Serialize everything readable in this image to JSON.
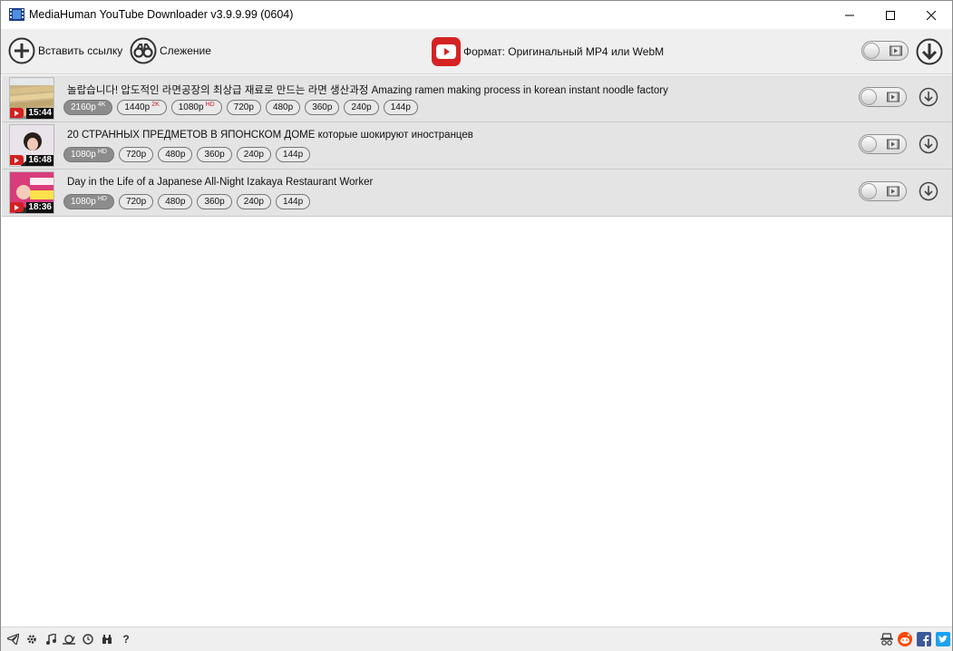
{
  "window": {
    "title": "MediaHuman YouTube Downloader v3.9.9.99 (0604)"
  },
  "toolbar": {
    "paste_label": "Вставить ссылку",
    "tracking_label": "Слежение",
    "format_label": "Формат: Оригинальный MP4 или WebM"
  },
  "items": [
    {
      "title": "놀랍습니다! 압도적인 라면공장의 최상급 재료로 만드는 라면 생산과정 Amazing ramen making process in korean instant noodle factory",
      "duration": "15:44",
      "qualities": [
        {
          "label": "2160p",
          "badge": "4K",
          "selected": true
        },
        {
          "label": "1440p",
          "badge": "2K",
          "selected": false
        },
        {
          "label": "1080p",
          "badge": "HD",
          "selected": false
        },
        {
          "label": "720p",
          "badge": "",
          "selected": false
        },
        {
          "label": "480p",
          "badge": "",
          "selected": false
        },
        {
          "label": "360p",
          "badge": "",
          "selected": false
        },
        {
          "label": "240p",
          "badge": "",
          "selected": false
        },
        {
          "label": "144p",
          "badge": "",
          "selected": false
        }
      ]
    },
    {
      "title": "20 СТРАННЫХ ПРЕДМЕТОВ В ЯПОНСКОМ ДОМЕ которые шокируют иностранцев",
      "duration": "16:48",
      "qualities": [
        {
          "label": "1080p",
          "badge": "HD",
          "selected": true
        },
        {
          "label": "720p",
          "badge": "",
          "selected": false
        },
        {
          "label": "480p",
          "badge": "",
          "selected": false
        },
        {
          "label": "360p",
          "badge": "",
          "selected": false
        },
        {
          "label": "240p",
          "badge": "",
          "selected": false
        },
        {
          "label": "144p",
          "badge": "",
          "selected": false
        }
      ]
    },
    {
      "title": "Day in the Life of a Japanese All-Night Izakaya Restaurant Worker",
      "duration": "18:36",
      "qualities": [
        {
          "label": "1080p",
          "badge": "HD",
          "selected": true
        },
        {
          "label": "720p",
          "badge": "",
          "selected": false
        },
        {
          "label": "480p",
          "badge": "",
          "selected": false
        },
        {
          "label": "360p",
          "badge": "",
          "selected": false
        },
        {
          "label": "240p",
          "badge": "",
          "selected": false
        },
        {
          "label": "144p",
          "badge": "",
          "selected": false
        }
      ]
    }
  ],
  "statusbar": {
    "left_icons": [
      "telegram-icon",
      "gear-icon",
      "music-note-icon",
      "snail-icon",
      "clock-icon",
      "binoculars-icon",
      "help-icon"
    ],
    "help_glyph": "?",
    "right_icons": [
      "incognito-icon",
      "reddit-icon",
      "facebook-icon",
      "twitter-icon"
    ]
  },
  "colors": {
    "accent_red": "#d52222",
    "toolbar_bg": "#efefef",
    "row_bg": "#e4e4e4",
    "chip_selected": "#8c8c8c",
    "badge_red": "#d0212c"
  }
}
